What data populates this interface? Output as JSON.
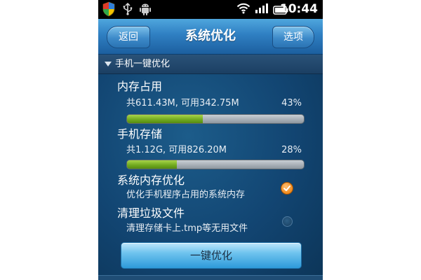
{
  "status_bar": {
    "time": "10:44",
    "left_icons": [
      "shield-icon",
      "usb-icon",
      "android-icon"
    ],
    "right_icons": [
      "wifi-icon",
      "signal-icon",
      "battery-icon"
    ]
  },
  "title_bar": {
    "back_label": "返回",
    "title": "系统优化",
    "options_label": "选项"
  },
  "section": {
    "label": "手机一键优化"
  },
  "memory": {
    "title": "内存占用",
    "detail": "共611.43M, 可用342.75M",
    "percent_text": "43%",
    "percent": 43
  },
  "storage": {
    "title": "手机存储",
    "detail": "共1.12G, 可用826.20M",
    "percent_text": "28%",
    "percent": 28
  },
  "options": [
    {
      "title": "系统内存优化",
      "description": "优化手机程序占用的系统内存",
      "checked": true
    },
    {
      "title": "清理垃圾文件",
      "description": "清理存储卡上.tmp等无用文件",
      "checked": false
    }
  ],
  "action": {
    "label": "一键优化"
  },
  "colors": {
    "title_bar": "#2f7fc2",
    "progress_fill": "#6fa81e",
    "check_accent": "#f08a1c",
    "background": "#124572"
  }
}
